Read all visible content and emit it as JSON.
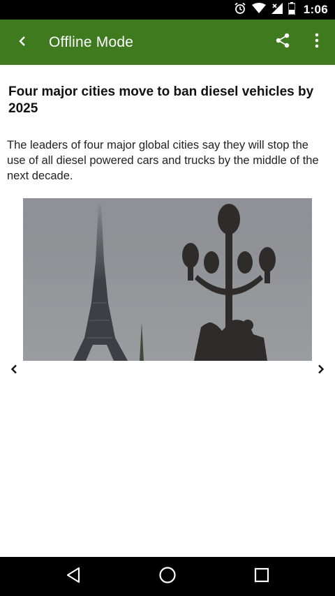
{
  "status_bar": {
    "time": "1:06",
    "icons": [
      "alarm-icon",
      "wifi-icon",
      "signal-icon",
      "battery-icon"
    ]
  },
  "toolbar": {
    "title": "Offline Mode",
    "back_icon": "back-arrow-icon",
    "share_icon": "share-icon",
    "more_icon": "more-vert-icon",
    "color": "#3f7a1f"
  },
  "article": {
    "headline": "Four major cities move to ban diesel vehicles by 2025",
    "summary": "The leaders of four major global cities say they will stop the use of all diesel powered cars and trucks by the middle of the next decade."
  },
  "gallery": {
    "prev_icon": "chevron-left-icon",
    "next_icon": "chevron-right-icon"
  },
  "nav_bar": {
    "back_icon": "nav-back-icon",
    "home_icon": "nav-home-icon",
    "recents_icon": "nav-recents-icon"
  }
}
